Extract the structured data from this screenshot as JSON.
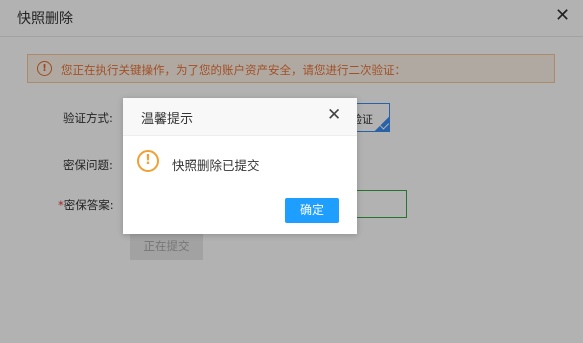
{
  "dialog": {
    "title": "快照删除",
    "close_glyph": "✕",
    "warning": {
      "icon": "!",
      "text": "您正在执行关键操作，为了您的账户资产安全，请您进行二次验证："
    },
    "form": {
      "method_label": "验证方式:",
      "method_value": "验证",
      "question_label": "密保问题:",
      "answer_required": "*",
      "answer_label": "密保答案:",
      "answer_value": "",
      "submit_label": "正在提交"
    }
  },
  "alert": {
    "title": "温馨提示",
    "close_glyph": "✕",
    "icon": "!",
    "message": "快照删除已提交",
    "ok_label": "确定"
  },
  "colors": {
    "warning": "#e8733a",
    "primary_button": "#1e9fff",
    "selected_border": "#3d8df0",
    "input_focus": "#3aa545",
    "alert_icon": "#f1a034"
  }
}
